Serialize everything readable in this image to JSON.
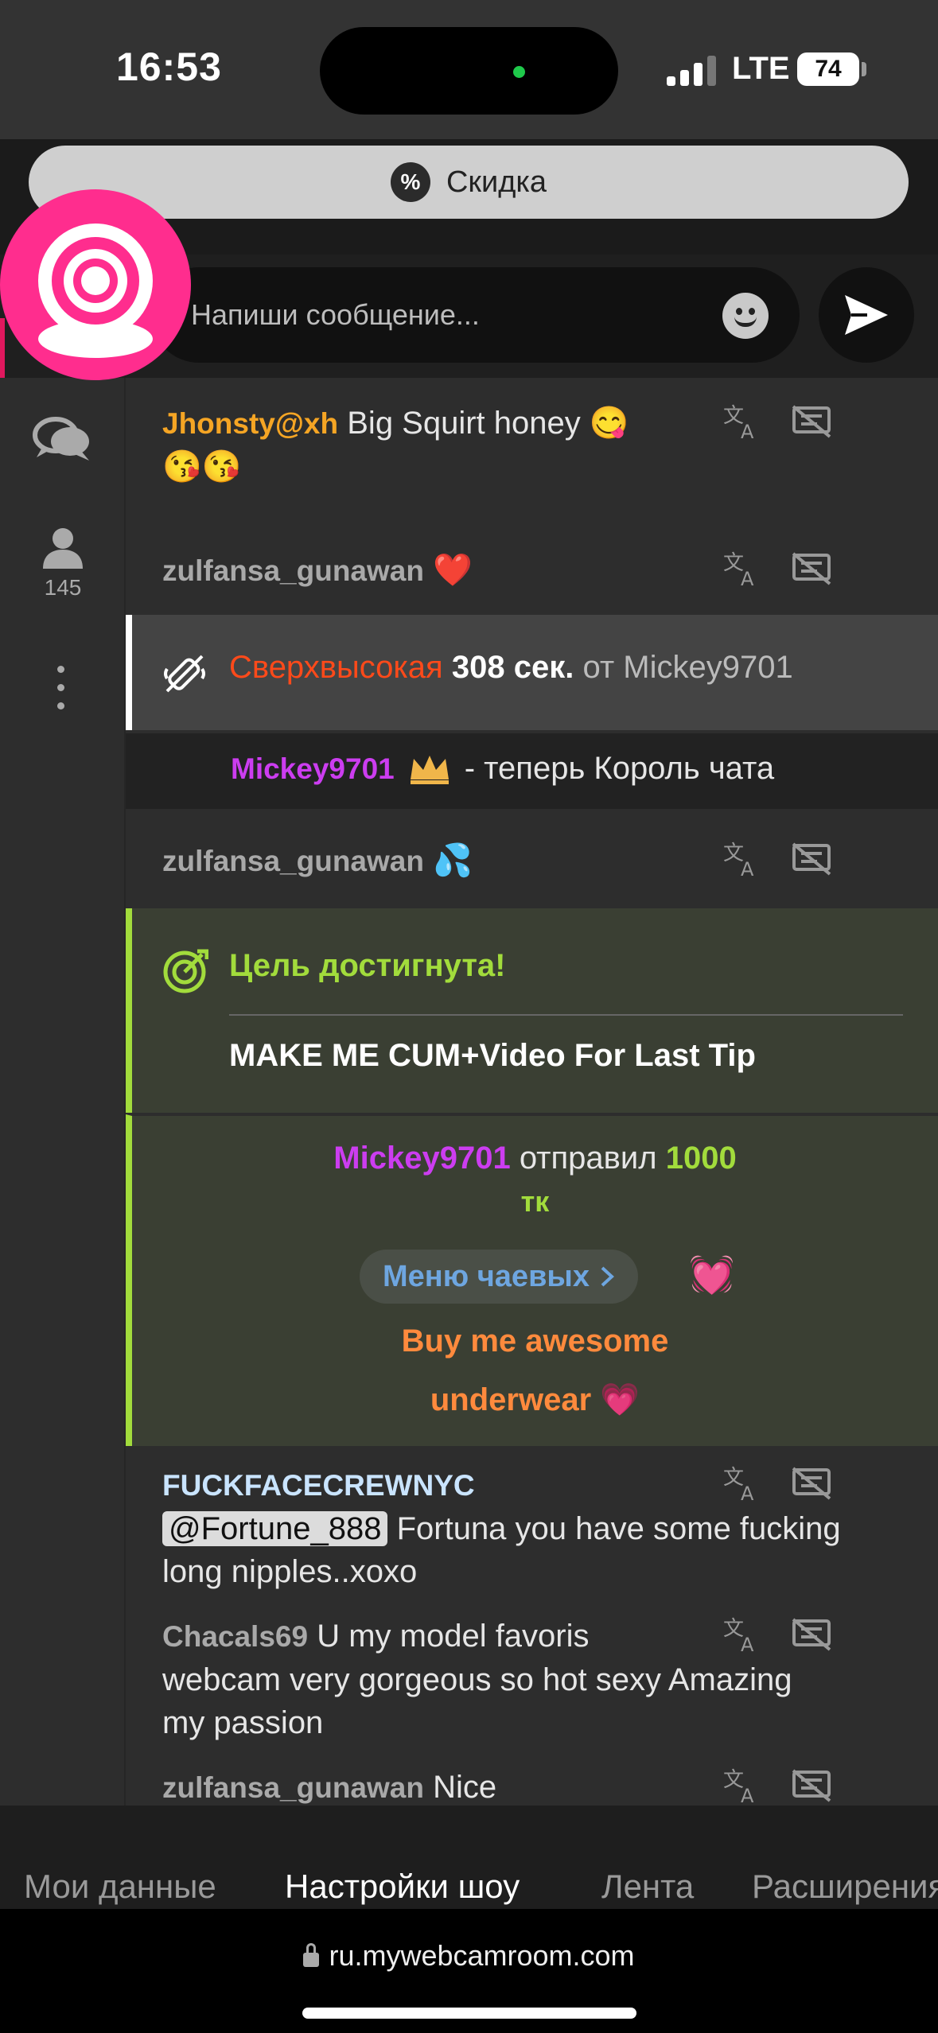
{
  "status": {
    "time": "16:53",
    "network": "LTE",
    "battery": "74"
  },
  "discount": {
    "icon": "%",
    "label": "Скидка"
  },
  "composer": {
    "placeholder": "Напиши сообщение..."
  },
  "sidebar": {
    "viewers": "145"
  },
  "chat": {
    "m1": {
      "user": "Jhonsty@xh",
      "text": "Big Squirt honey 😋",
      "line2": "😘😘"
    },
    "m2": {
      "user": "zulfansa_gunawan",
      "text": "❤️"
    },
    "sys1": {
      "level": "Сверхвысокая",
      "duration": "308 сек.",
      "from": "от",
      "user": "Mickey9701"
    },
    "king": {
      "user": "Mickey9701",
      "text": "- теперь Король чата"
    },
    "m3": {
      "user": "zulfansa_gunawan",
      "text": "💦"
    },
    "goal": {
      "title": "Цель достигнута!",
      "text": "MAKE ME CUM+Video For Last Tip"
    },
    "tip": {
      "user": "Mickey9701",
      "sent": "отправил",
      "amount": "1000",
      "currency": "тк",
      "menu": "Меню чаевых",
      "heart": "💓",
      "item_line1": "Buy me awesome",
      "item_line2": "underwear",
      "item_heart": "💗"
    },
    "m4": {
      "user": "FUCKFACECREWNYC",
      "mention": "@Fortune_888",
      "text": "Fortuna you have some fucking",
      "line2": "long nipples..xoxo"
    },
    "m5": {
      "user": "Chacals69",
      "text": "U my model favoris",
      "line2": "webcam very gorgeous so hot sexy Amazing",
      "line3": "my passion"
    },
    "m6": {
      "user": "zulfansa_gunawan",
      "text": "Nice"
    }
  },
  "tabs": [
    "Мои данные",
    "Настройки шоу",
    "Лента",
    "Расширения"
  ],
  "url": "ru.mywebcamroom.com",
  "colors": {
    "brand": "#ff2d8e",
    "goal": "#a2dc3c",
    "highlight": "#ff4a1a",
    "username_purple": "#cc3df0",
    "tip_item": "#ff8a3d",
    "tip_menu": "#6ea6e0"
  }
}
